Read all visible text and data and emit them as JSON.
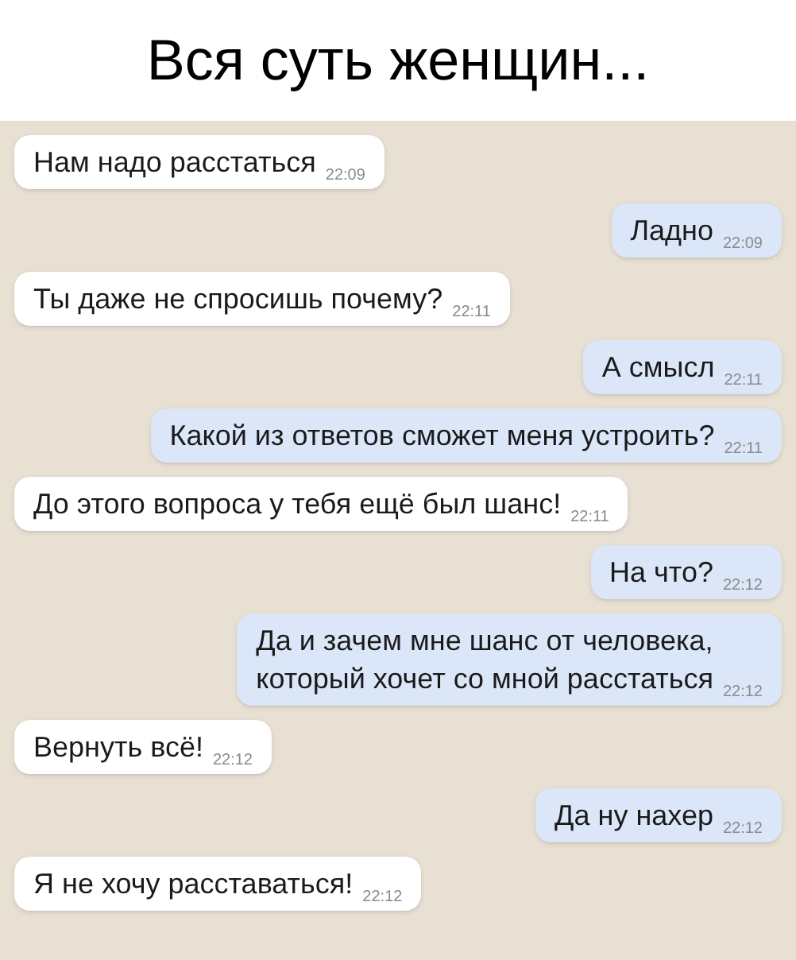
{
  "title": "Вся суть женщин...",
  "messages": [
    {
      "kind": "incoming",
      "text": "Нам надо расстаться",
      "time": "22:09"
    },
    {
      "kind": "outgoing",
      "text": "Ладно",
      "time": "22:09"
    },
    {
      "kind": "incoming",
      "text": "Ты даже не спросишь почему?",
      "time": "22:11"
    },
    {
      "kind": "outgoing",
      "text": "А смысл",
      "time": "22:11"
    },
    {
      "kind": "outgoing",
      "text": "Какой из ответов сможет меня устроить?",
      "time": "22:11"
    },
    {
      "kind": "incoming",
      "text": "До этого вопроса у тебя ещё был шанс!",
      "time": "22:11"
    },
    {
      "kind": "outgoing",
      "text": "На что?",
      "time": "22:12"
    },
    {
      "kind": "outgoing",
      "text": "Да и зачем мне шанс от человека,\nкоторый хочет со мной расстаться",
      "time": "22:12"
    },
    {
      "kind": "incoming",
      "text": "Вернуть всё!",
      "time": "22:12"
    },
    {
      "kind": "outgoing",
      "text": "Да ну нахер",
      "time": "22:12"
    },
    {
      "kind": "incoming",
      "text": "Я не хочу расставаться!",
      "time": "22:12"
    }
  ]
}
